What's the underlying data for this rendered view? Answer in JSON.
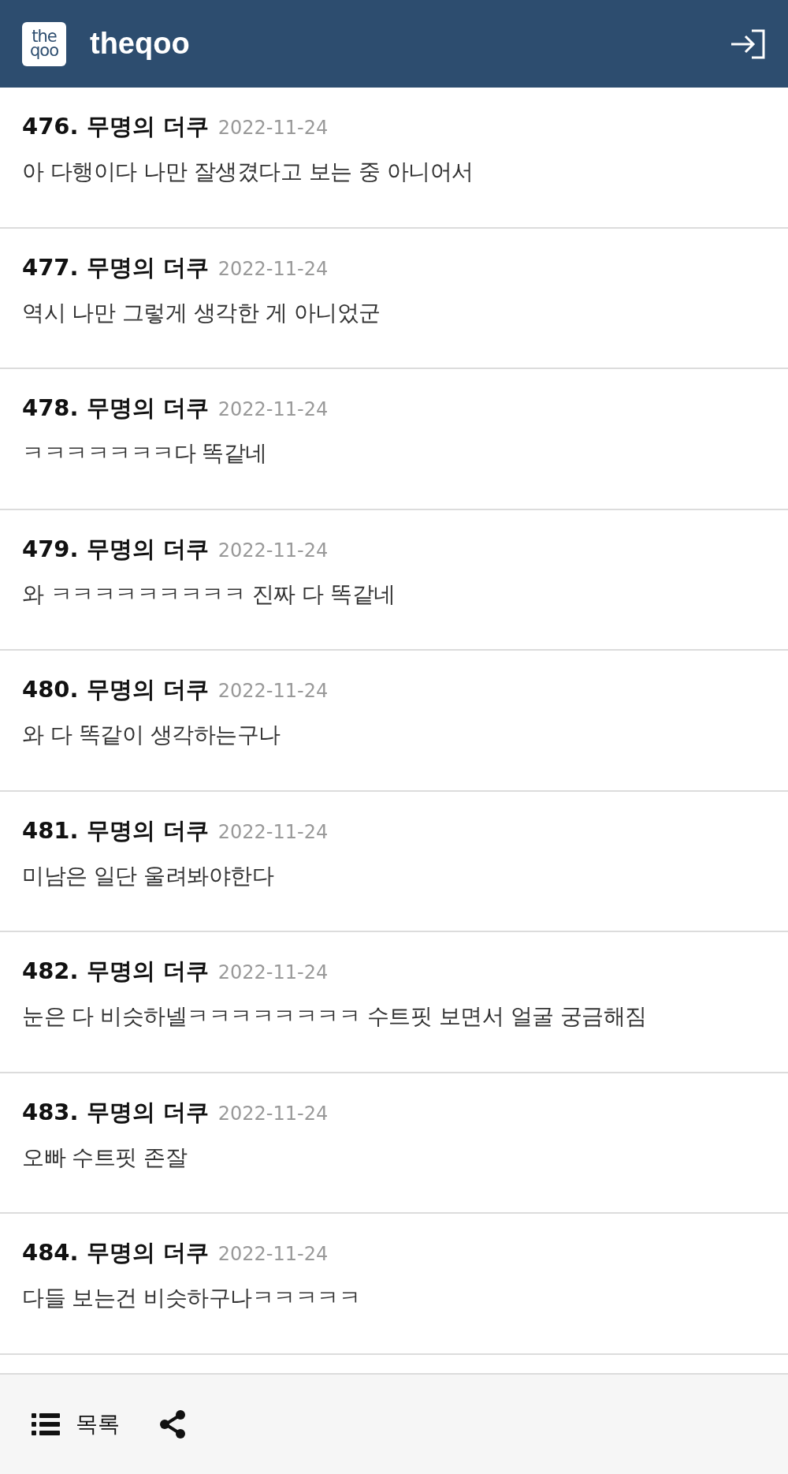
{
  "header": {
    "logo_lines": [
      "the",
      "qoo"
    ],
    "title": "theqoo"
  },
  "comments": [
    {
      "number": "476.",
      "author": "무명의 더쿠",
      "date": "2022-11-24",
      "text": "아 다행이다 나만 잘생겼다고 보는 중 아니어서"
    },
    {
      "number": "477.",
      "author": "무명의 더쿠",
      "date": "2022-11-24",
      "text": "역시 나만 그렇게 생각한 게 아니었군"
    },
    {
      "number": "478.",
      "author": "무명의 더쿠",
      "date": "2022-11-24",
      "text": "ㅋㅋㅋㅋㅋㅋㅋ다 똑같네"
    },
    {
      "number": "479.",
      "author": "무명의 더쿠",
      "date": "2022-11-24",
      "text": "와 ㅋㅋㅋㅋㅋㅋㅋㅋㅋ 진짜 다 똑같네"
    },
    {
      "number": "480.",
      "author": "무명의 더쿠",
      "date": "2022-11-24",
      "text": "와 다 똑같이 생각하는구나"
    },
    {
      "number": "481.",
      "author": "무명의 더쿠",
      "date": "2022-11-24",
      "text": "미남은 일단 울려봐야한다"
    },
    {
      "number": "482.",
      "author": "무명의 더쿠",
      "date": "2022-11-24",
      "text": "눈은 다 비슷하넬ㅋㅋㅋㅋㅋㅋㅋㅋ 수트핏 보면서 얼굴 궁금해짐"
    },
    {
      "number": "483.",
      "author": "무명의 더쿠",
      "date": "2022-11-24",
      "text": "오빠 수트핏 존잘"
    },
    {
      "number": "484.",
      "author": "무명의 더쿠",
      "date": "2022-11-24",
      "text": "다들 보는건 비슷하구나ㅋㅋㅋㅋㅋ"
    }
  ],
  "footer": {
    "list_label": "목록"
  }
}
